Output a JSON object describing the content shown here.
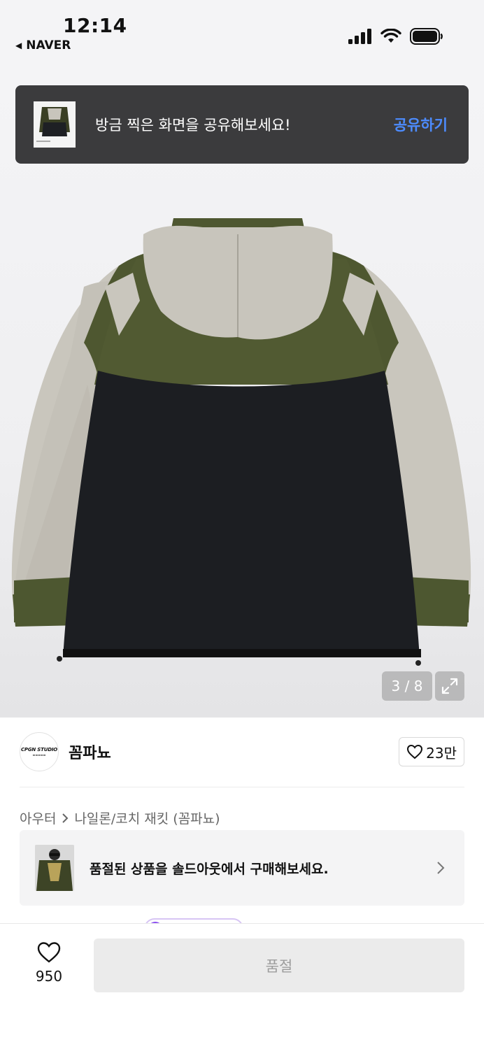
{
  "status_bar": {
    "time": "12:14",
    "back_app": "NAVER",
    "icons": [
      "signal-icon",
      "wifi-icon",
      "battery-icon"
    ]
  },
  "share_banner": {
    "text": "방금 찍은 화면을 공유해보세요!",
    "button": "공유하기",
    "button_color": "#4d8cff"
  },
  "gallery": {
    "counter": "3 / 8",
    "current": 3,
    "total": 8
  },
  "brand": {
    "logo_text": "CPGN STUDIO",
    "name": "꼼파뇨",
    "likes": "23만"
  },
  "breadcrumb": {
    "category": "아우터",
    "subcategory": "나일론/코치 재킷 (꼼파뇨)"
  },
  "soldout_banner": {
    "text": "품절된 상품을 솔드아웃에서 구매해보세요."
  },
  "bottom_bar": {
    "wish_count": "950",
    "buy_label": "품절"
  }
}
